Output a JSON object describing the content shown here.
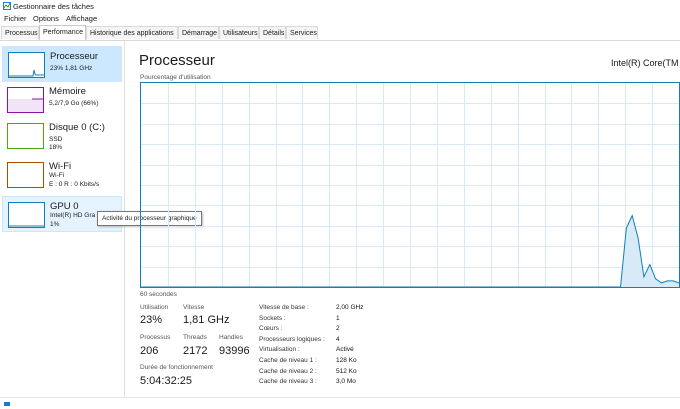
{
  "window": {
    "title": "Gestionnaire des tâches",
    "icon": "task-manager-icon"
  },
  "menu": [
    "Fichier",
    "Options",
    "Affichage"
  ],
  "tabs": [
    {
      "label": "Processus",
      "active": false
    },
    {
      "label": "Performance",
      "active": true
    },
    {
      "label": "Historique des applications",
      "active": false
    },
    {
      "label": "Démarrage",
      "active": false
    },
    {
      "label": "Utilisateurs",
      "active": false
    },
    {
      "label": "Détails",
      "active": false
    },
    {
      "label": "Services",
      "active": false
    }
  ],
  "sidebar": {
    "items": [
      {
        "title": "Processeur",
        "lines": [
          "23% 1,81 GHz"
        ],
        "color": "#117dbb",
        "selected": true
      },
      {
        "title": "Mémoire",
        "lines": [
          "5,2/7,9 Go (66%)"
        ],
        "color": "#8b12ae",
        "selected": false
      },
      {
        "title": "Disque 0 (C:)",
        "lines": [
          "SSD",
          "18%"
        ],
        "color": "#4da60c",
        "selected": false
      },
      {
        "title": "Wi-Fi",
        "lines": [
          "Wi-Fi",
          "E : 0  R : 0 Kbits/s"
        ],
        "color": "#a74f01",
        "selected": false
      },
      {
        "title": "GPU 0",
        "lines": [
          "Intel(R) HD Gra",
          "1%"
        ],
        "color": "#117dbb",
        "selected": false
      }
    ]
  },
  "tooltip": "Activité du processeur graphique",
  "main": {
    "title": "Processeur",
    "model": "Intel(R) Core(TM",
    "usage_label": "Pourcentage d'utilisation",
    "time_label": "60 secondes"
  },
  "graph": {
    "color": "#117dbb",
    "fill": "#d9eaf7",
    "grid_color": "#d9eaf4",
    "usage_series": [
      0,
      0,
      0,
      0,
      0,
      0,
      0,
      0,
      0,
      0,
      0,
      0,
      0,
      0,
      0,
      0,
      0,
      0,
      0,
      0,
      0,
      0,
      0,
      0,
      0,
      0,
      0,
      0,
      0,
      0,
      0,
      0,
      0,
      0,
      0,
      0,
      0,
      0,
      0,
      0,
      0,
      0,
      0,
      0,
      0,
      0,
      0,
      0,
      0,
      0,
      0,
      0,
      0,
      0,
      0,
      0,
      0,
      0,
      0,
      0,
      0,
      0,
      0,
      0,
      0,
      0,
      0,
      0,
      0,
      0,
      0,
      0,
      0,
      0,
      0,
      0,
      0,
      0,
      0,
      0,
      0,
      0,
      0,
      29,
      35,
      24,
      5,
      11,
      4,
      2,
      3,
      3,
      2
    ]
  },
  "stats": {
    "utilisation": {
      "label": "Utilisation",
      "value": "23%"
    },
    "vitesse": {
      "label": "Vitesse",
      "value": "1,81 GHz"
    },
    "processus": {
      "label": "Processus",
      "value": "206"
    },
    "threads": {
      "label": "Threads",
      "value": "2172"
    },
    "handles": {
      "label": "Handles",
      "value": "93996"
    },
    "uptime": {
      "label": "Durée de fonctionnement",
      "value": "5:04:32:25"
    }
  },
  "details": [
    {
      "label": "Vitesse de base :",
      "value": "2,00 GHz"
    },
    {
      "label": "Sockets :",
      "value": "1"
    },
    {
      "label": "Cœurs :",
      "value": "2"
    },
    {
      "label": "Processeurs logiques :",
      "value": "4"
    },
    {
      "label": "Virtualisation :",
      "value": "Activé"
    },
    {
      "label": "Cache de niveau 1 :",
      "value": "128 Ko"
    },
    {
      "label": "Cache de niveau 2 :",
      "value": "512 Ko"
    },
    {
      "label": "Cache de niveau 3 :",
      "value": "3,0 Mo"
    }
  ]
}
